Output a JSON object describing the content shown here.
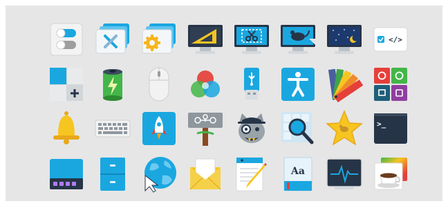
{
  "window": {
    "background": "#e6e6e6"
  },
  "icon_grid": {
    "rows": [
      [
        {
          "name": "toggle-switches-icon"
        },
        {
          "name": "window-preferences-icon"
        },
        {
          "name": "system-settings-icon"
        },
        {
          "name": "monitor-ruler-icon"
        },
        {
          "name": "screenshot-scissors-icon"
        },
        {
          "name": "display-mouse-icon"
        },
        {
          "name": "night-screensaver-icon"
        },
        {
          "name": "code-editor-icon"
        }
      ],
      [
        {
          "name": "layout-tiles-icon"
        },
        {
          "name": "battery-charging-icon"
        },
        {
          "name": "mouse-icon"
        },
        {
          "name": "rgb-colors-icon"
        },
        {
          "name": "usb-drive-icon"
        },
        {
          "name": "accessibility-icon"
        },
        {
          "name": "color-swatches-icon"
        },
        {
          "name": "app-grid-icon"
        }
      ],
      [
        {
          "name": "bell-icon"
        },
        {
          "name": "keyboard-icon"
        },
        {
          "name": "rocket-launcher-icon"
        },
        {
          "name": "network-signpost-icon"
        },
        {
          "name": "detective-cat-icon"
        },
        {
          "name": "search-magnifier-icon"
        },
        {
          "name": "star-favorites-icon"
        },
        {
          "name": "terminal-icon"
        }
      ],
      [
        {
          "name": "workspace-switcher-icon"
        },
        {
          "name": "file-cabinet-icon"
        },
        {
          "name": "globe-network-icon"
        },
        {
          "name": "mail-envelope-icon"
        },
        {
          "name": "text-editor-pencil-icon"
        },
        {
          "name": "dictionary-book-icon"
        },
        {
          "name": "system-monitor-icon"
        },
        {
          "name": "coffee-cup-icon"
        }
      ]
    ]
  },
  "icon_texts": {
    "code_editor": "</>",
    "dictionary": "Aa",
    "terminal_prompt": ">_"
  },
  "colors": {
    "accent_blue": "#1aa7e0",
    "dark_screen": "#263447",
    "yellow": "#f7c520",
    "green": "#43b649",
    "red": "#e5403a"
  }
}
